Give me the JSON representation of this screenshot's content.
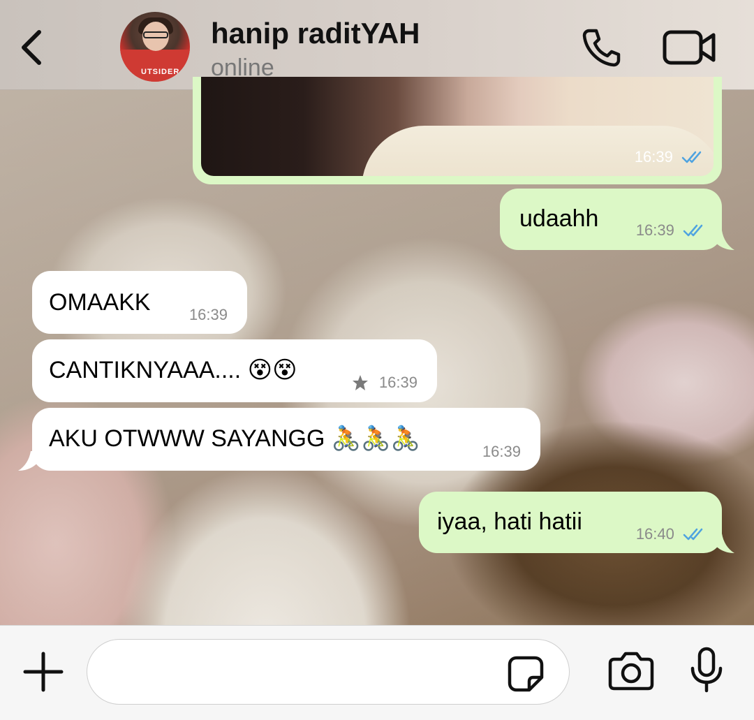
{
  "header": {
    "contact_name": "hanip raditYAH",
    "status": "online",
    "avatar_shirt_text": "UTSIDER"
  },
  "messages": [
    {
      "direction": "outgoing",
      "type": "image",
      "time": "16:39",
      "read": true
    },
    {
      "direction": "outgoing",
      "type": "text",
      "text": "udaahh",
      "time": "16:39",
      "read": true
    },
    {
      "direction": "incoming",
      "type": "text",
      "text": "OMAAKK",
      "time": "16:39"
    },
    {
      "direction": "incoming",
      "type": "text",
      "text": "CANTIKNYAAA.... 😵😵",
      "time": "16:39",
      "starred": true
    },
    {
      "direction": "incoming",
      "type": "text",
      "text": "AKU OTWWW SAYANGG 🚴🚴🚴",
      "time": "16:39"
    },
    {
      "direction": "outgoing",
      "type": "text",
      "text": "iyaa, hati hatii",
      "time": "16:40",
      "read": true
    }
  ],
  "input": {
    "placeholder": "",
    "value": ""
  },
  "colors": {
    "outgoing_bubble": "#dcf8c6",
    "incoming_bubble": "#ffffff",
    "read_receipt": "#4fa3e0",
    "header_bg": "#d8d0ca",
    "input_bar_bg": "#f6f6f6"
  },
  "icons": {
    "back": "chevron-left-icon",
    "call": "phone-icon",
    "video": "video-camera-icon",
    "attach": "plus-icon",
    "sticker": "sticker-icon",
    "camera": "camera-icon",
    "mic": "microphone-icon",
    "star": "star-icon",
    "read": "double-check-icon"
  }
}
